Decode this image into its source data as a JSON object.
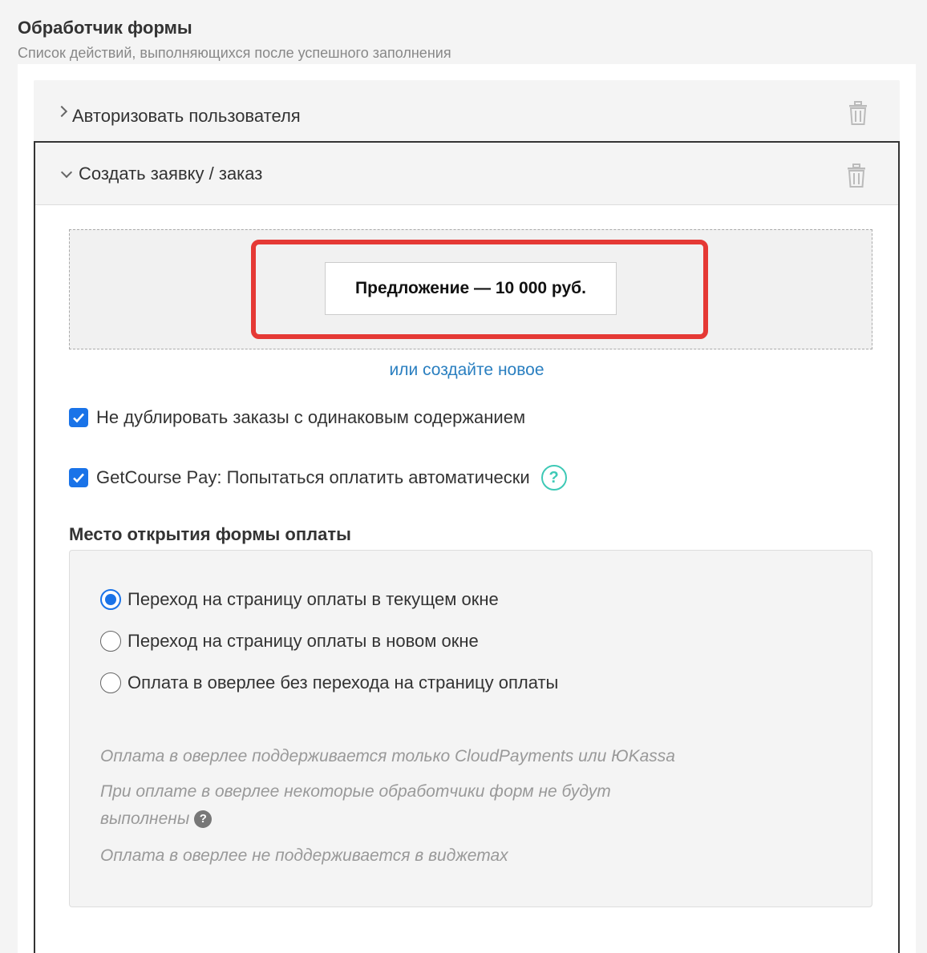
{
  "section": {
    "title": "Обработчик формы",
    "subtitle": "Список действий, выполняющихся после успешного заполнения"
  },
  "actions": [
    {
      "label": "Авторизовать пользователя",
      "expanded": false
    },
    {
      "label": "Создать заявку / заказ",
      "expanded": true
    }
  ],
  "order": {
    "offer_label": "Предложение — 10 000 руб.",
    "create_new_link": "или создайте новое",
    "no_duplicates_label": "Не дублировать заказы с одинаковым содержанием",
    "no_duplicates_checked": true,
    "gc_pay_label": "GetCourse Pay: Попытаться оплатить автоматически",
    "gc_pay_checked": true
  },
  "payment_place": {
    "title": "Место открытия формы оплаты",
    "options": [
      {
        "label": "Переход на страницу оплаты в текущем окне",
        "selected": true
      },
      {
        "label": "Переход на страницу оплаты в новом окне",
        "selected": false
      },
      {
        "label": "Оплата в оверлее без перехода на страницу оплаты",
        "selected": false
      }
    ],
    "notes": [
      "Оплата в оверлее поддерживается только CloudPayments или ЮKassa",
      "При оплате в оверлее некоторые обработчики форм не будут выполнены",
      "Оплата в оверлее не поддерживается в виджетах"
    ]
  },
  "colors": {
    "accent": "#1a73e8",
    "link": "#2a7fc0",
    "highlight": "#e53935",
    "help": "#3ec9b6"
  },
  "icons": {
    "collapsed": "chevron-right-icon",
    "expanded": "chevron-down-icon",
    "delete": "trash-icon",
    "help": "question-circle-icon"
  }
}
